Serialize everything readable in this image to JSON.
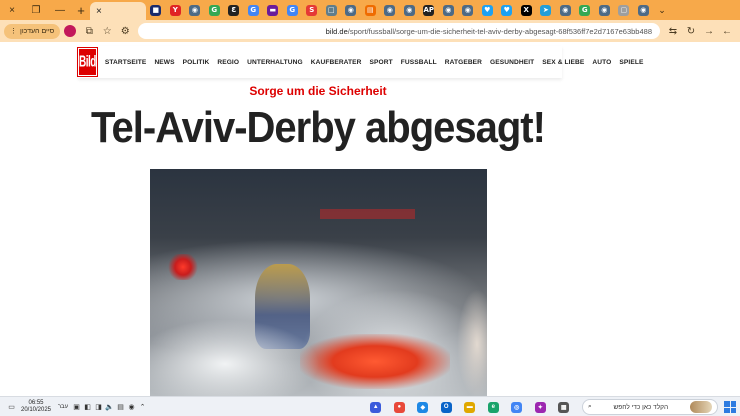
{
  "tabstrip": {
    "window_controls": [
      "×",
      "❐",
      "—"
    ],
    "active_tab_close": "×",
    "new_tab": "+",
    "tab_menu": "⌄",
    "tabs": [
      {
        "icon": "tab-favicon-sofascore",
        "color": "#1b2a6b",
        "glyph": "■"
      },
      {
        "icon": "tab-favicon-red",
        "color": "#e02424",
        "glyph": "Y"
      },
      {
        "icon": "tab-favicon-1",
        "color": "#4d6a86",
        "glyph": "◉"
      },
      {
        "icon": "tab-favicon-2",
        "color": "#34a853",
        "glyph": "G"
      },
      {
        "icon": "tab-favicon-3",
        "color": "#222222",
        "glyph": "Ɛ"
      },
      {
        "icon": "tab-favicon-4",
        "color": "#4285f4",
        "glyph": "G"
      },
      {
        "icon": "tab-favicon-5",
        "color": "#6a1b9a",
        "glyph": "▬"
      },
      {
        "icon": "tab-favicon-6",
        "color": "#4285f4",
        "glyph": "G"
      },
      {
        "icon": "tab-favicon-7",
        "color": "#e53935",
        "glyph": "S"
      },
      {
        "icon": "tab-favicon-8",
        "color": "#607d8b",
        "glyph": "□"
      },
      {
        "icon": "tab-favicon-9",
        "color": "#4d6a86",
        "glyph": "◉"
      },
      {
        "icon": "tab-favicon-10",
        "color": "#ef6c00",
        "glyph": "▤"
      },
      {
        "icon": "tab-favicon-11",
        "color": "#4d6a86",
        "glyph": "◉"
      },
      {
        "icon": "tab-favicon-12",
        "color": "#4d6a86",
        "glyph": "◉"
      },
      {
        "icon": "tab-favicon-13",
        "color": "#222222",
        "glyph": "AP"
      },
      {
        "icon": "tab-favicon-14",
        "color": "#4d6a86",
        "glyph": "◉"
      },
      {
        "icon": "tab-favicon-15",
        "color": "#4d6a86",
        "glyph": "◉"
      },
      {
        "icon": "tab-favicon-16",
        "color": "#1da1f2",
        "glyph": "♥"
      },
      {
        "icon": "tab-favicon-17",
        "color": "#1da1f2",
        "glyph": "♥"
      },
      {
        "icon": "tab-favicon-18",
        "color": "#000000",
        "glyph": "X"
      },
      {
        "icon": "tab-favicon-19",
        "color": "#229ed9",
        "glyph": "➤"
      },
      {
        "icon": "tab-favicon-20",
        "color": "#4d6a86",
        "glyph": "◉"
      },
      {
        "icon": "tab-favicon-21",
        "color": "#34a853",
        "glyph": "G"
      },
      {
        "icon": "tab-favicon-22",
        "color": "#4d6a86",
        "glyph": "◉"
      },
      {
        "icon": "tab-favicon-23",
        "color": "#9e9e9e",
        "glyph": "▢"
      },
      {
        "icon": "tab-favicon-24",
        "color": "#4d6a86",
        "glyph": "◉"
      }
    ]
  },
  "toolbar": {
    "profile_label": "סיים העדכון",
    "url_host": "bild.de",
    "url_path": "/sport/fussball/sorge-um-die-sicherheit-tel-aviv-derby-abgesagt-68f536ff7e2d7167e63bb488"
  },
  "site": {
    "logo": "Bild",
    "nav": [
      "STARTSEITE",
      "NEWS",
      "POLITIK",
      "REGIO",
      "UNTERHALTUNG",
      "KAUFBERATER",
      "SPORT",
      "FUSSBALL",
      "RATGEBER",
      "GESUNDHEIT",
      "SEX & LIEBE",
      "AUTO",
      "SPIELE"
    ]
  },
  "article": {
    "kicker": "Sorge um die Sicherheit",
    "headline": "Tel-Aviv-Derby abgesagt!"
  },
  "taskbar": {
    "time": "06:55",
    "date": "20/10/2025",
    "lang": "עבר",
    "search_placeholder": "הקלד כאן כדי לחפש",
    "apps": [
      {
        "name": "taskbar-app-1",
        "color": "#3b5bdb",
        "glyph": "▲"
      },
      {
        "name": "taskbar-app-2",
        "color": "#e8493a",
        "glyph": "●"
      },
      {
        "name": "taskbar-app-3",
        "color": "#1e88e5",
        "glyph": "◆"
      },
      {
        "name": "taskbar-app-outlook",
        "color": "#0a64c8",
        "glyph": "O"
      },
      {
        "name": "taskbar-app-5",
        "color": "#e0a800",
        "glyph": "▬"
      },
      {
        "name": "taskbar-app-edge",
        "color": "#1aa36b",
        "glyph": "e"
      },
      {
        "name": "taskbar-app-chrome",
        "color": "#4285f4",
        "glyph": "◎"
      },
      {
        "name": "taskbar-app-8",
        "color": "#9c27b0",
        "glyph": "✦"
      },
      {
        "name": "taskbar-app-9",
        "color": "#555555",
        "glyph": "▦"
      }
    ]
  }
}
